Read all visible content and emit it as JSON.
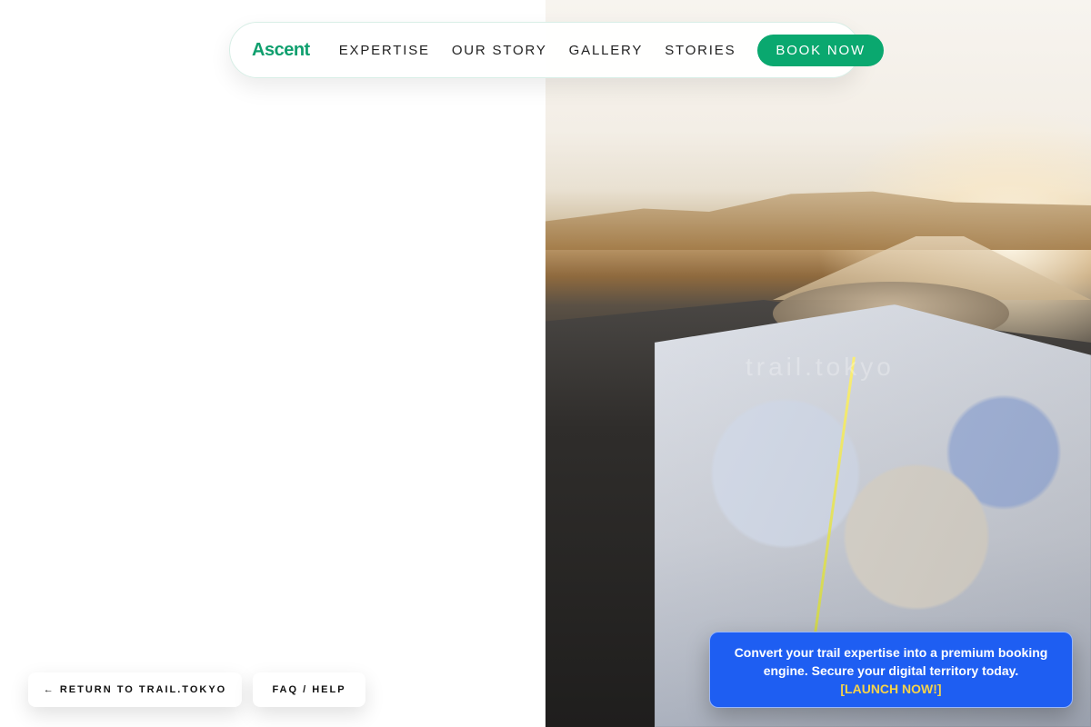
{
  "brand": {
    "name": "Ascent"
  },
  "nav": {
    "links": [
      "EXPERTISE",
      "OUR STORY",
      "GALLERY",
      "STORIES"
    ],
    "cta_label": "BOOK NOW"
  },
  "hero": {
    "watermark_text": "trail.tokyo"
  },
  "bottom_buttons": {
    "return_label": "← RETURN TO TRAIL.TOKYO",
    "faq_label": "FAQ / HELP"
  },
  "promo": {
    "text": "Convert your trail expertise into a premium booking engine. Secure your digital territory today.",
    "link_label": "[LAUNCH NOW!]"
  },
  "colors": {
    "accent": "#0aa86f",
    "promo_bg": "#1e5ef2",
    "promo_link": "#f6d34a"
  }
}
